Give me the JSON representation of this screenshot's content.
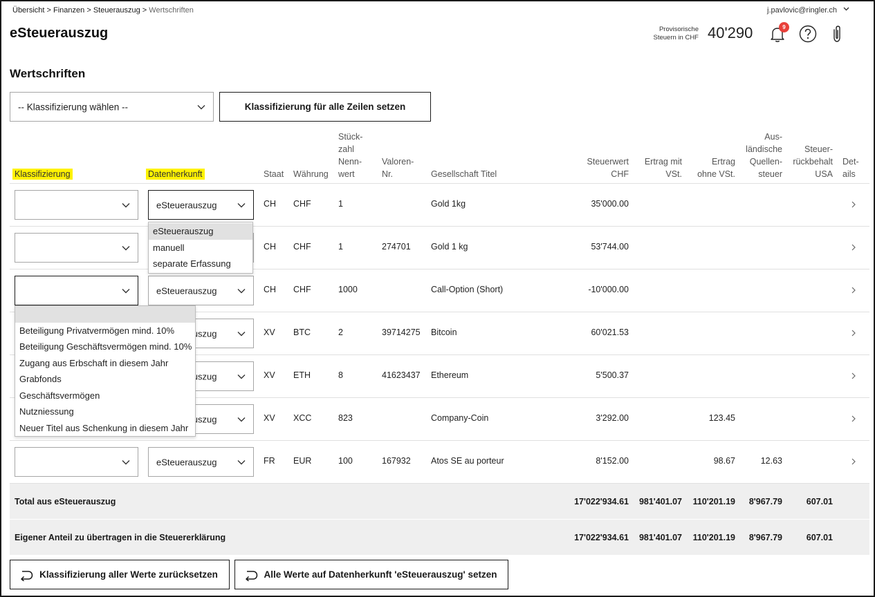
{
  "breadcrumb": {
    "items": [
      "Übersicht",
      "Finanzen",
      "Steuerauszug"
    ],
    "current": "Wertschriften",
    "separator": " > "
  },
  "user": {
    "email": "j.pavlovic@ringler.ch"
  },
  "header": {
    "title": "eSteuerauszug",
    "provisional_label_1": "Provisorische",
    "provisional_label_2": "Steuern in CHF",
    "provisional_value": "40'290",
    "notification_count": "9"
  },
  "section": {
    "title": "Wertschriften"
  },
  "bulk": {
    "select_value": "-- Klassifizierung wählen --",
    "apply_button": "Klassifizierung für alle Zeilen setzen"
  },
  "columns": {
    "klassifizierung": "Klassifizierung",
    "datenherkunft": "Datenherkunft",
    "staat": "Staat",
    "waehrung": "Währung",
    "stueckzahl": [
      "Stück-",
      "zahl",
      "Nenn-",
      "wert"
    ],
    "valoren": [
      "Valoren-",
      "Nr."
    ],
    "gesellschaft": "Gesellschaft Titel",
    "steuerwert": [
      "Steuerwert",
      "CHF"
    ],
    "ertrag_mit": [
      "Ertrag mit",
      "VSt."
    ],
    "ertrag_ohne": [
      "Ertrag",
      "ohne VSt."
    ],
    "auslaendisch": [
      "Aus-",
      "ländische",
      "Quellen-",
      "steuer"
    ],
    "rueckbehalt": [
      "Steuer-",
      "rückbehalt",
      "USA"
    ],
    "details": [
      "Det-",
      "ails"
    ]
  },
  "rows": [
    {
      "klassifizierung": "",
      "datenherkunft": "eSteuerauszug",
      "staat": "CH",
      "waehrung": "CHF",
      "stueckzahl": "1",
      "valoren": "",
      "gesellschaft": "Gold 1kg",
      "steuerwert": "35'000.00",
      "ertrag_mit": "",
      "ertrag_ohne": "",
      "auslaendisch": "",
      "rueckbehalt": ""
    },
    {
      "klassifizierung": "",
      "datenherkunft": "eSteuerauszug",
      "staat": "CH",
      "waehrung": "CHF",
      "stueckzahl": "1",
      "valoren": "274701",
      "gesellschaft": "Gold 1 kg",
      "steuerwert": "53'744.00",
      "ertrag_mit": "",
      "ertrag_ohne": "",
      "auslaendisch": "",
      "rueckbehalt": ""
    },
    {
      "klassifizierung": "",
      "datenherkunft": "eSteuerauszug",
      "staat": "CH",
      "waehrung": "CHF",
      "stueckzahl": "1000",
      "valoren": "",
      "gesellschaft": "Call-Option (Short)",
      "steuerwert": "-10'000.00",
      "ertrag_mit": "",
      "ertrag_ohne": "",
      "auslaendisch": "",
      "rueckbehalt": ""
    },
    {
      "klassifizierung": "",
      "datenherkunft": "eSteuerauszug",
      "staat": "XV",
      "waehrung": "BTC",
      "stueckzahl": "2",
      "valoren": "39714275",
      "gesellschaft": "Bitcoin",
      "steuerwert": "60'021.53",
      "ertrag_mit": "",
      "ertrag_ohne": "",
      "auslaendisch": "",
      "rueckbehalt": ""
    },
    {
      "klassifizierung": "",
      "datenherkunft": "eSteuerauszug",
      "staat": "XV",
      "waehrung": "ETH",
      "stueckzahl": "8",
      "valoren": "41623437",
      "gesellschaft": "Ethereum",
      "steuerwert": "5'500.37",
      "ertrag_mit": "",
      "ertrag_ohne": "",
      "auslaendisch": "",
      "rueckbehalt": ""
    },
    {
      "klassifizierung": "",
      "datenherkunft": "eSteuerauszug",
      "staat": "XV",
      "waehrung": "XCC",
      "stueckzahl": "823",
      "valoren": "",
      "gesellschaft": "Company-Coin",
      "steuerwert": "3'292.00",
      "ertrag_mit": "",
      "ertrag_ohne": "123.45",
      "auslaendisch": "",
      "rueckbehalt": ""
    },
    {
      "klassifizierung": "",
      "datenherkunft": "eSteuerauszug",
      "staat": "FR",
      "waehrung": "EUR",
      "stueckzahl": "100",
      "valoren": "167932",
      "gesellschaft": "Atos SE au porteur",
      "steuerwert": "8'152.00",
      "ertrag_mit": "",
      "ertrag_ohne": "98.67",
      "auslaendisch": "12.63",
      "rueckbehalt": ""
    }
  ],
  "datenherkunft_options": [
    "eSteuerauszug",
    "manuell",
    "separate Erfassung"
  ],
  "klassifizierung_options": [
    "",
    "Beteiligung Privatvermögen mind. 10%",
    "Beteiligung Geschäftsvermögen mind. 10%",
    "Zugang aus Erbschaft in diesem Jahr",
    "Grabfonds",
    "Geschäftsvermögen",
    "Nutzniessung",
    "Neuer Titel aus Schenkung in diesem Jahr"
  ],
  "totals": [
    {
      "label": "Total aus eSteuerauszug",
      "steuerwert": "17'022'934.61",
      "ertrag_mit": "981'401.07",
      "ertrag_ohne": "110'201.19",
      "auslaendisch": "8'967.79",
      "rueckbehalt": "607.01"
    },
    {
      "label": "Eigener Anteil zu übertragen in die Steuererklärung",
      "steuerwert": "17'022'934.61",
      "ertrag_mit": "981'401.07",
      "ertrag_ohne": "110'201.19",
      "auslaendisch": "8'967.79",
      "rueckbehalt": "607.01"
    }
  ],
  "actions": {
    "reset_button": "Klassifizierung aller Werte zurücksetzen",
    "restore_button": "Alle Werte auf Datenherkunft 'eSteuerauszug' setzen"
  }
}
